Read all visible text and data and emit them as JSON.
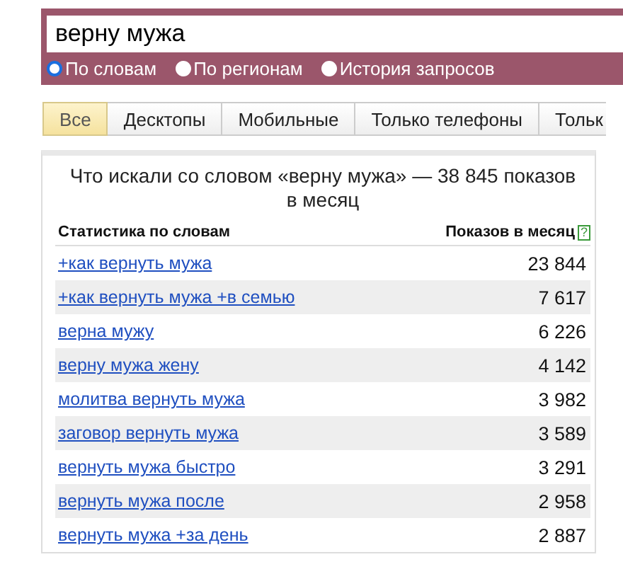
{
  "search": {
    "value": "верну мужа"
  },
  "modes": [
    {
      "label": "По словам",
      "selected": true
    },
    {
      "label": "По регионам",
      "selected": false
    },
    {
      "label": "История запросов",
      "selected": false
    }
  ],
  "tabs": [
    {
      "label": "Все",
      "selected": true
    },
    {
      "label": "Десктопы",
      "selected": false
    },
    {
      "label": "Мобильные",
      "selected": false
    },
    {
      "label": "Только телефоны",
      "selected": false
    },
    {
      "label": "Тольк",
      "selected": false
    }
  ],
  "panel": {
    "title": "Что искали со словом «верну мужа» — 38 845 показов в месяц",
    "columns": [
      "Статистика по словам",
      "Показов в месяц"
    ],
    "help": "?",
    "rows": [
      {
        "phrase": "+как вернуть мужа",
        "count": "23 844"
      },
      {
        "phrase": "+как вернуть мужа +в семью",
        "count": "7 617"
      },
      {
        "phrase": "верна мужу",
        "count": "6 226"
      },
      {
        "phrase": "верну мужа жену",
        "count": "4 142"
      },
      {
        "phrase": "молитва вернуть мужа",
        "count": "3 982"
      },
      {
        "phrase": "заговор вернуть мужа",
        "count": "3 589"
      },
      {
        "phrase": "вернуть мужа быстро",
        "count": "3 291"
      },
      {
        "phrase": "вернуть мужа после",
        "count": "2 958"
      },
      {
        "phrase": "вернуть мужа +за день",
        "count": "2 887"
      }
    ]
  }
}
